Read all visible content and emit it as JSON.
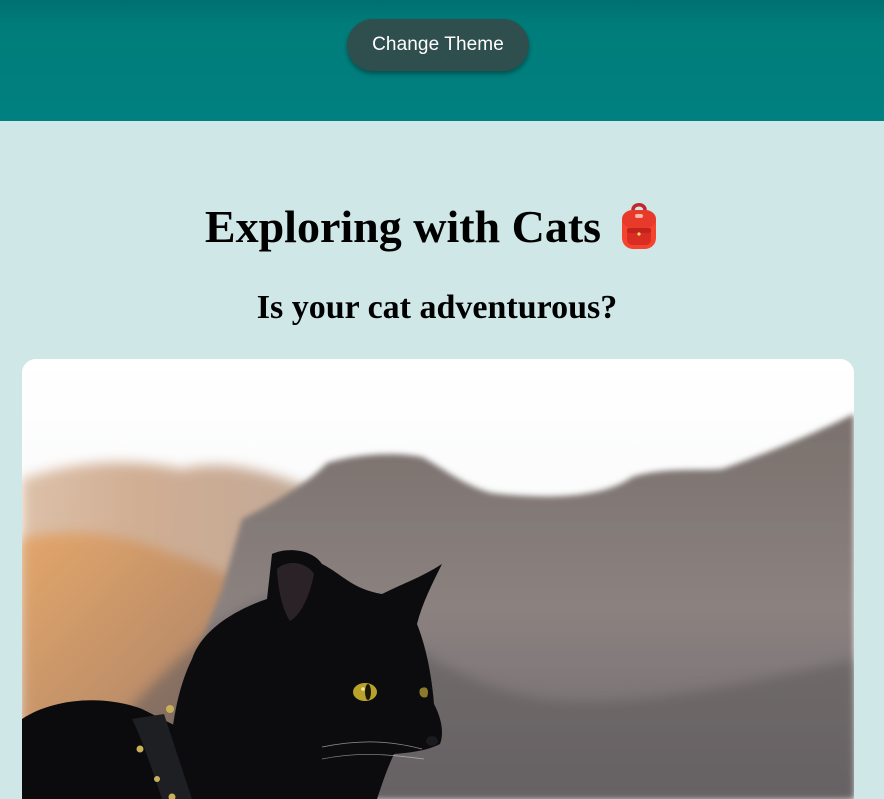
{
  "header": {
    "theme_button_label": "Change Theme"
  },
  "main": {
    "title": "Exploring with Cats",
    "title_icon": "backpack-icon",
    "subtitle": "Is your cat adventurous?",
    "photo": {
      "subject": "cat-photo"
    }
  },
  "colors": {
    "header_bg": "#008080",
    "button_bg": "#2e4f4d",
    "page_bg": "#cfe7e7"
  }
}
